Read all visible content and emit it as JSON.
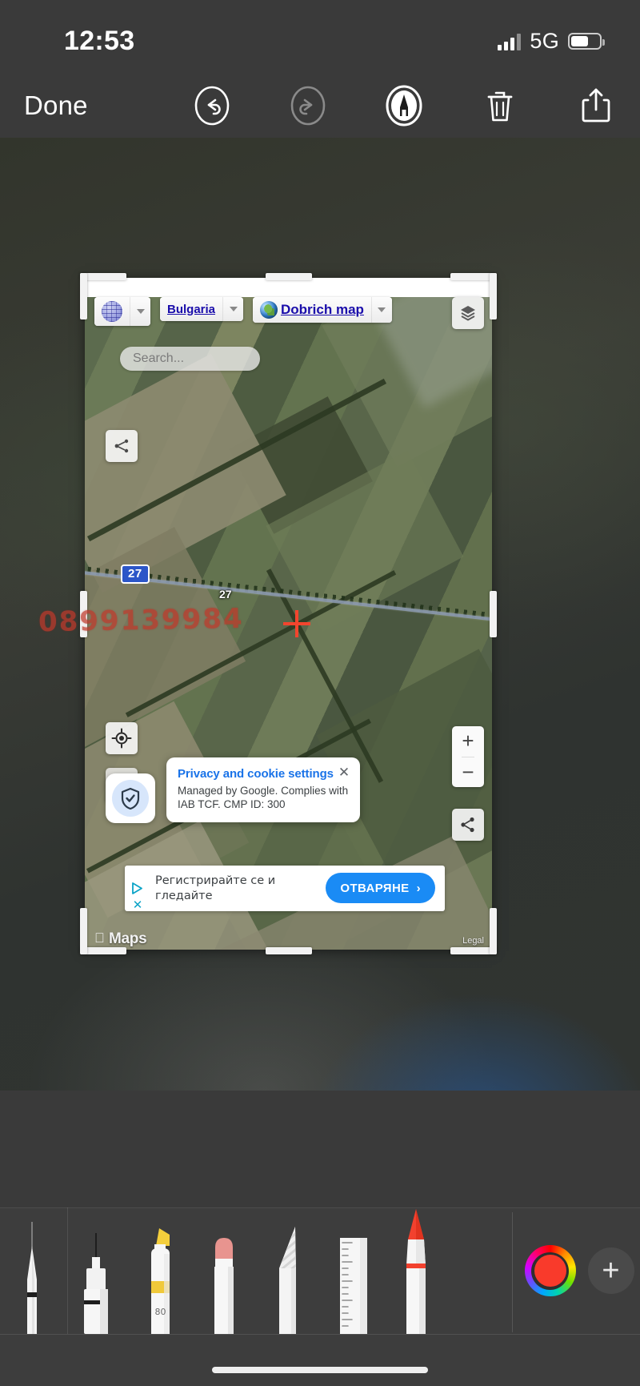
{
  "status_bar": {
    "time": "12:53",
    "network": "5G",
    "signal_icon": "cellular-bars-icon",
    "battery_icon": "battery-icon"
  },
  "markup_toolbar": {
    "done_label": "Done",
    "icons": [
      {
        "name": "undo-icon",
        "label": "Undo",
        "enabled": true
      },
      {
        "name": "redo-icon",
        "label": "Redo",
        "enabled": false
      },
      {
        "name": "markup-pen-icon",
        "label": "Markup",
        "enabled": true
      },
      {
        "name": "trash-icon",
        "label": "Delete",
        "enabled": true
      },
      {
        "name": "share-icon",
        "label": "Share",
        "enabled": true
      }
    ]
  },
  "photo": {
    "map_page": {
      "nav_chips": [
        {
          "icon": "globe-icon",
          "label": "",
          "has_dropdown": true
        },
        {
          "icon": "",
          "label": "Bulgaria",
          "has_dropdown": true
        },
        {
          "icon": "earth-icon",
          "label": "Dobrich map",
          "has_dropdown": true
        }
      ],
      "search": {
        "placeholder": "Search...",
        "value": ""
      },
      "controls": {
        "layers": "layers-icon",
        "fork": "fork-routes-icon",
        "locate": "locate-me-icon",
        "zoom_in": "+",
        "zoom_out": "−",
        "share": "share-node-icon"
      },
      "road": {
        "shield": "27",
        "label": "27"
      },
      "crosshair": "map-crosshair-marker",
      "privacy_card": {
        "title": "Privacy and cookie settings",
        "body": "Managed by Google. Complies with IAB TCF. CMP ID: 300",
        "close_label": "✕",
        "shield_icon": "shield-check-icon"
      },
      "ad_banner": {
        "text": "Регистрирайте се и гледайте",
        "cta_label": "ОТВАРЯНЕ",
        "cta_arrow": "›",
        "adchoices_icon": "adchoices-icon",
        "close_label": "✕"
      },
      "footer": {
        "maps_label": "Maps",
        "legal_label": "Legal",
        "apple_logo": ""
      }
    },
    "annotation": {
      "text": "0899139984",
      "color": "#c0392b"
    }
  },
  "tool_palette": {
    "tools": [
      {
        "name": "pen-tool",
        "label": "Pen",
        "selected": false
      },
      {
        "name": "marker-tool",
        "label": "Marker",
        "selected": false
      },
      {
        "name": "highlighter-tool",
        "label": "Highlighter",
        "selected": false,
        "badge": "80"
      },
      {
        "name": "eraser-tool",
        "label": "Eraser",
        "selected": false
      },
      {
        "name": "lasso-tool",
        "label": "Lasso",
        "selected": false
      },
      {
        "name": "ruler-tool",
        "label": "Ruler",
        "selected": false
      },
      {
        "name": "pencil-tool",
        "label": "Pencil",
        "selected": true
      }
    ],
    "color_wheel": {
      "name": "color-picker",
      "selected_color": "#f93a2b"
    },
    "add_button": {
      "name": "add-color-button",
      "label": "+"
    }
  },
  "colors": {
    "toolbar_bg": "#3a3a3a",
    "palette_bg": "#3d3d3d",
    "link_blue": "#1a0dab",
    "google_blue": "#1a73e8",
    "cta_blue": "#1a8bf5",
    "annotation_red": "#c0392b",
    "selected_color": "#f93a2b"
  }
}
